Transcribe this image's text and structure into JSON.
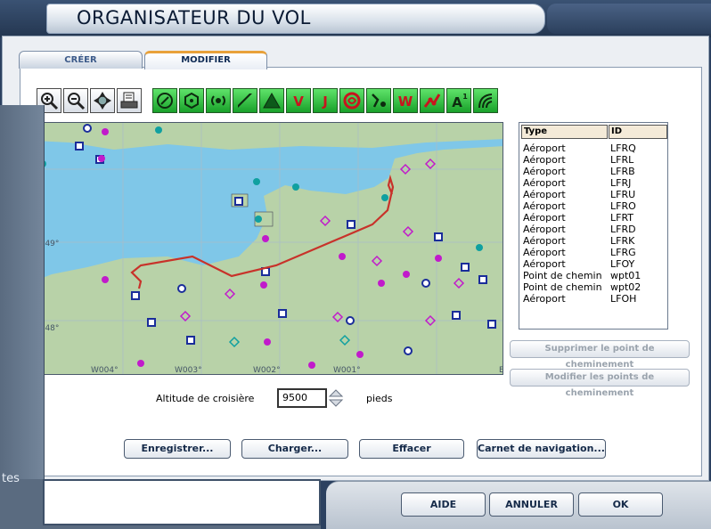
{
  "window": {
    "title": "ORGANISATEUR DU VOL"
  },
  "tabs": [
    {
      "label": "CRÉER",
      "active": false
    },
    {
      "label": "MODIFIER",
      "active": true
    }
  ],
  "toolbar": {
    "items": [
      "zoom-in-icon",
      "zoom-out-icon",
      "center-icon",
      "print-icon",
      "vor-icon",
      "ndb-icon",
      "ils-icon",
      "airport-icon",
      "triangle-icon",
      "vor-route-icon",
      "jet-route-icon",
      "restricted-icon",
      "airway-icon",
      "waypoint-icon",
      "high-low-icon",
      "altitude-icon",
      "terrain-icon"
    ]
  },
  "map": {
    "grid_labels": [
      "N049°",
      "N048°",
      "W004°",
      "W003°",
      "W002°",
      "W001°",
      "E"
    ],
    "colors": {
      "water": "#7fc7e8",
      "land": "#b8d2a8",
      "route": "#c8322a"
    }
  },
  "list": {
    "headers": {
      "type": "Type",
      "id": "ID"
    },
    "rows": [
      {
        "type": "Aéroport",
        "id": "LFRQ"
      },
      {
        "type": "Aéroport",
        "id": "LFRL"
      },
      {
        "type": "Aéroport",
        "id": "LFRB"
      },
      {
        "type": "Aéroport",
        "id": "LFRJ"
      },
      {
        "type": "Aéroport",
        "id": "LFRU"
      },
      {
        "type": "Aéroport",
        "id": "LFRO"
      },
      {
        "type": "Aéroport",
        "id": "LFRT"
      },
      {
        "type": "Aéroport",
        "id": "LFRD"
      },
      {
        "type": "Aéroport",
        "id": "LFRK"
      },
      {
        "type": "Aéroport",
        "id": "LFRG"
      },
      {
        "type": "Aéroport",
        "id": "LFOY"
      },
      {
        "type": "Point de chemin",
        "id": "wpt01"
      },
      {
        "type": "Point de chemin",
        "id": "wpt02"
      },
      {
        "type": "Aéroport",
        "id": "LFOH"
      }
    ]
  },
  "side_buttons": {
    "delete": "Supprimer le point de cheminement",
    "modify": "Modifier les points de cheminement"
  },
  "altitude": {
    "label": "Altitude de croisière",
    "value": "9500",
    "unit": "pieds"
  },
  "actions": {
    "save": "Enregistrer...",
    "load": "Charger...",
    "clear": "Effacer",
    "navlog": "Carnet de navigation..."
  },
  "footer": {
    "help": "AIDE",
    "cancel": "ANNULER",
    "ok": "OK"
  },
  "left_panel": {
    "partial_text": "tes"
  }
}
